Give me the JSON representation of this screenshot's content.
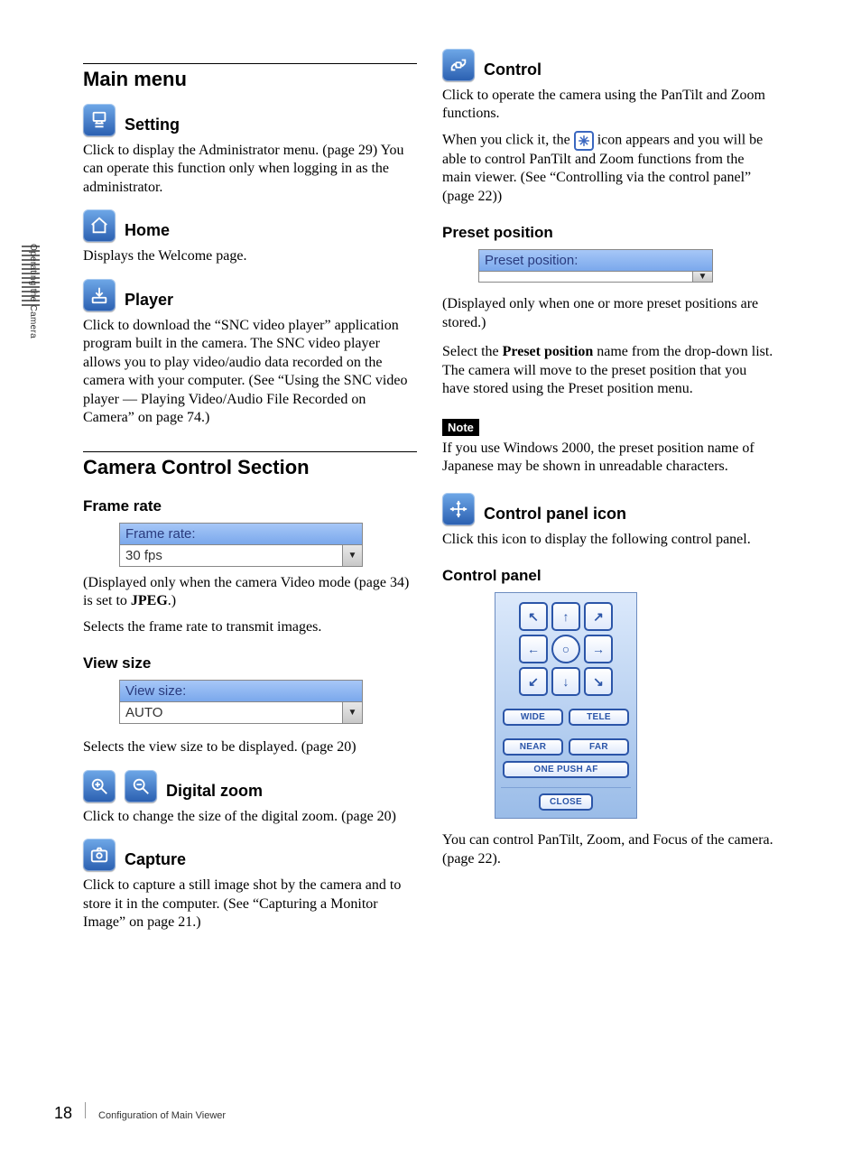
{
  "side_tab": "Operating the Camera",
  "left": {
    "main_menu_h": "Main menu",
    "setting_h": "Setting",
    "setting_p": "Click to display the Administrator menu. (page 29) You can operate this function only when logging in as the administrator.",
    "home_h": "Home",
    "home_p": "Displays the Welcome page.",
    "player_h": "Player",
    "player_p": "Click to download the “SNC video player” application program built in the camera. The SNC video player allows you to play video/audio data recorded on the camera with your computer. (See “Using the SNC video player — Playing Video/Audio File Recorded on Camera” on page 74.)",
    "ccs_h": "Camera Control Section",
    "framerate_h": "Frame rate",
    "framerate_label": "Frame rate:",
    "framerate_value": "30 fps",
    "framerate_note_a": "(Displayed only when the camera Video mode (page 34) is set to ",
    "framerate_note_b": "JPEG",
    "framerate_note_c": ".)",
    "framerate_p2": "Selects the frame rate to transmit images.",
    "viewsize_h": "View size",
    "viewsize_label": "View size:",
    "viewsize_value": "AUTO",
    "viewsize_p": "Selects the view size to be displayed. (page 20)",
    "dzoom_h": "Digital zoom",
    "dzoom_p": "Click to change the size of the digital zoom. (page 20)",
    "capture_h": "Capture",
    "capture_p": "Click to capture a still image shot by the camera and to store it in the computer. (See “Capturing a Monitor Image” on page 21.)"
  },
  "right": {
    "control_h": "Control",
    "control_p1": "Click to operate the camera using the PanTilt and Zoom functions.",
    "control_p2a": "When you click it, the ",
    "control_p2b": " icon appears and you will be able to control PanTilt and Zoom functions from the main viewer. (See “Controlling via the control panel” (page 22))",
    "preset_h": "Preset position",
    "preset_label": "Preset position:",
    "preset_value": "",
    "preset_note": "(Displayed only when one or more preset positions are stored.)",
    "preset_p_a": "Select the ",
    "preset_p_b": "Preset position",
    "preset_p_c": " name from the drop-down list.  The camera will move to the preset position that you have stored using the Preset position menu.",
    "note_label": "Note",
    "note_p": "If you use Windows 2000, the preset position name of Japanese may be shown in unreadable characters.",
    "cpicon_h": "Control panel icon",
    "cpicon_p": "Click this icon to display the following control panel.",
    "cpanel_h": "Control panel",
    "cp_wide": "WIDE",
    "cp_tele": "TELE",
    "cp_near": "NEAR",
    "cp_far": "FAR",
    "cp_onepush": "ONE PUSH AF",
    "cp_close": "CLOSE",
    "cpanel_p": "You can control PanTilt, Zoom, and Focus of the camera. (page 22)."
  },
  "footer": {
    "page": "18",
    "crumb": "Configuration of Main Viewer"
  }
}
